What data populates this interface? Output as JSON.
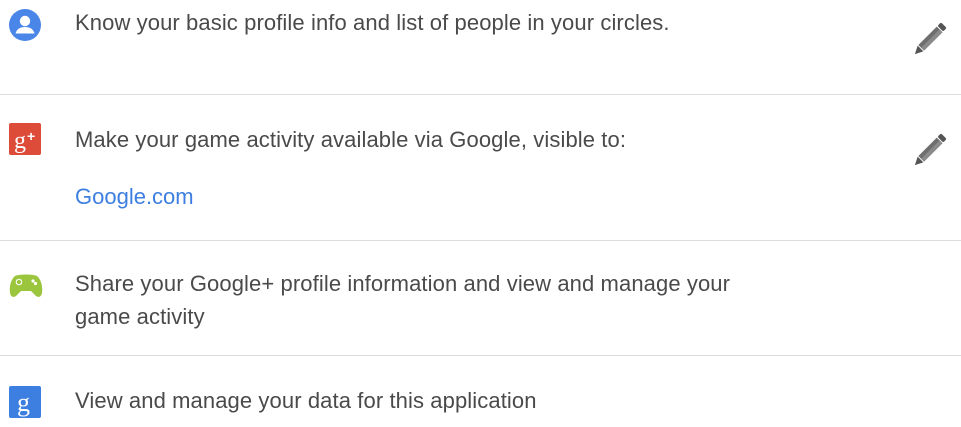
{
  "permissions": [
    {
      "icon": "profile-person-icon",
      "text": "Know your basic profile info and list of people in your circles.",
      "editable": true
    },
    {
      "icon": "google-plus-icon",
      "text": "Make your game activity available via Google, visible to:",
      "link": "Google.com",
      "editable": true
    },
    {
      "icon": "game-controller-icon",
      "text_line1": "Share your Google+ profile information and view and manage your",
      "text_line2": "game activity",
      "editable": false
    },
    {
      "icon": "google-g-icon",
      "text": "View and manage your data for this application",
      "editable": false
    }
  ],
  "colors": {
    "profile_blue": "#4a86e8",
    "google_plus_red": "#dd4b39",
    "games_green": "#9bc53d",
    "google_blue": "#3d7fe0",
    "link_blue": "#3d7fe0",
    "divider": "#dcdcdc",
    "text": "#4a4a4a",
    "pencil": "#6e6e6e"
  }
}
